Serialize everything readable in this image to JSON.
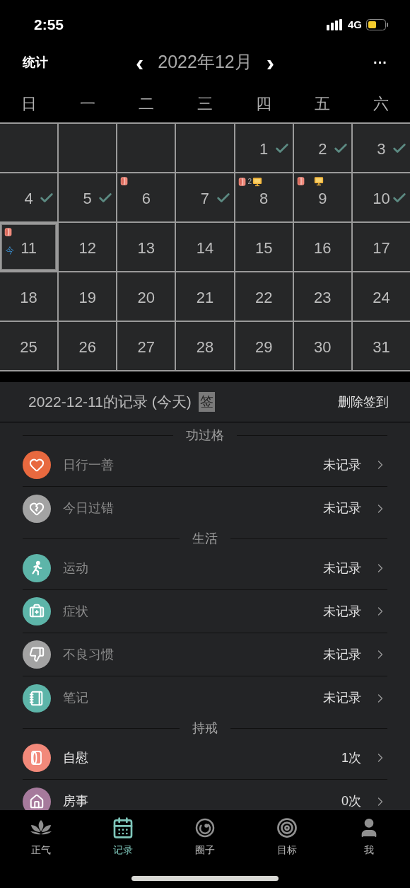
{
  "status_bar": {
    "time": "2:55",
    "network": "4G"
  },
  "header": {
    "left": "统计",
    "prev": "‹",
    "title": "2022年12月",
    "next": "›",
    "more": "···"
  },
  "weekdays": [
    "日",
    "一",
    "二",
    "三",
    "四",
    "五",
    "六"
  ],
  "calendar": [
    {
      "kind": "blank"
    },
    {
      "kind": "blank"
    },
    {
      "kind": "blank"
    },
    {
      "kind": "blank"
    },
    {
      "kind": "day",
      "day": "1",
      "checked": true,
      "selected": false,
      "roll": false,
      "screen": false
    },
    {
      "kind": "day",
      "day": "2",
      "checked": true,
      "selected": false,
      "roll": false,
      "screen": false
    },
    {
      "kind": "day",
      "day": "3",
      "checked": true,
      "selected": false,
      "roll": false,
      "screen": false
    },
    {
      "kind": "day",
      "day": "4",
      "checked": true,
      "selected": false,
      "roll": false,
      "screen": false
    },
    {
      "kind": "day",
      "day": "5",
      "checked": true,
      "selected": false,
      "roll": false,
      "screen": false
    },
    {
      "kind": "day",
      "day": "6",
      "checked": false,
      "selected": false,
      "roll": true,
      "screen": false
    },
    {
      "kind": "day",
      "day": "7",
      "checked": true,
      "selected": false,
      "roll": false,
      "screen": false
    },
    {
      "kind": "day",
      "day": "8",
      "checked": false,
      "selected": false,
      "roll": true,
      "roll_count": "2",
      "screen": true
    },
    {
      "kind": "day",
      "day": "9",
      "checked": false,
      "selected": false,
      "roll": true,
      "screen": true
    },
    {
      "kind": "day",
      "day": "10",
      "checked": true,
      "selected": false,
      "roll": false,
      "screen": false
    },
    {
      "kind": "day",
      "day": "11",
      "checked": false,
      "selected": true,
      "roll": true,
      "screen": false,
      "today_label": "今"
    },
    {
      "kind": "day",
      "day": "12",
      "checked": false,
      "selected": false,
      "roll": false,
      "screen": false
    },
    {
      "kind": "day",
      "day": "13",
      "checked": false,
      "selected": false,
      "roll": false,
      "screen": false
    },
    {
      "kind": "day",
      "day": "14",
      "checked": false,
      "selected": false,
      "roll": false,
      "screen": false
    },
    {
      "kind": "day",
      "day": "15",
      "checked": false,
      "selected": false,
      "roll": false,
      "screen": false
    },
    {
      "kind": "day",
      "day": "16",
      "checked": false,
      "selected": false,
      "roll": false,
      "screen": false
    },
    {
      "kind": "day",
      "day": "17",
      "checked": false,
      "selected": false,
      "roll": false,
      "screen": false
    },
    {
      "kind": "day",
      "day": "18",
      "checked": false,
      "selected": false,
      "roll": false,
      "screen": false
    },
    {
      "kind": "day",
      "day": "19",
      "checked": false,
      "selected": false,
      "roll": false,
      "screen": false
    },
    {
      "kind": "day",
      "day": "20",
      "checked": false,
      "selected": false,
      "roll": false,
      "screen": false
    },
    {
      "kind": "day",
      "day": "21",
      "checked": false,
      "selected": false,
      "roll": false,
      "screen": false
    },
    {
      "kind": "day",
      "day": "22",
      "checked": false,
      "selected": false,
      "roll": false,
      "screen": false
    },
    {
      "kind": "day",
      "day": "23",
      "checked": false,
      "selected": false,
      "roll": false,
      "screen": false
    },
    {
      "kind": "day",
      "day": "24",
      "checked": false,
      "selected": false,
      "roll": false,
      "screen": false
    },
    {
      "kind": "day",
      "day": "25",
      "checked": false,
      "selected": false,
      "roll": false,
      "screen": false
    },
    {
      "kind": "day",
      "day": "26",
      "checked": false,
      "selected": false,
      "roll": false,
      "screen": false
    },
    {
      "kind": "day",
      "day": "27",
      "checked": false,
      "selected": false,
      "roll": false,
      "screen": false
    },
    {
      "kind": "day",
      "day": "28",
      "checked": false,
      "selected": false,
      "roll": false,
      "screen": false
    },
    {
      "kind": "day",
      "day": "29",
      "checked": false,
      "selected": false,
      "roll": false,
      "screen": false
    },
    {
      "kind": "day",
      "day": "30",
      "checked": false,
      "selected": false,
      "roll": false,
      "screen": false
    },
    {
      "kind": "day",
      "day": "31",
      "checked": false,
      "selected": false,
      "roll": false,
      "screen": false
    }
  ],
  "record": {
    "title": "2022-12-11的记录 (今天)",
    "badge": "签",
    "action": "删除签到"
  },
  "sections": [
    {
      "title": "功过格",
      "items": [
        {
          "color": "#e8693f",
          "label": "日行一善",
          "value": "未记录",
          "recorded": false
        },
        {
          "color": "#a3a3a3",
          "label": "今日过错",
          "value": "未记录",
          "recorded": false
        }
      ]
    },
    {
      "title": "生活",
      "items": [
        {
          "color": "#5db5a9",
          "label": "运动",
          "value": "未记录",
          "recorded": false
        },
        {
          "color": "#5db5a9",
          "label": "症状",
          "value": "未记录",
          "recorded": false
        },
        {
          "color": "#a3a3a3",
          "label": "不良习惯",
          "value": "未记录",
          "recorded": false
        },
        {
          "color": "#5db5a9",
          "label": "笔记",
          "value": "未记录",
          "recorded": false
        }
      ]
    },
    {
      "title": "持戒",
      "items": [
        {
          "color": "#f2897a",
          "label": "自慰",
          "value": "1次",
          "recorded": true
        },
        {
          "color": "#a67a9c",
          "label": "房事",
          "value": "0次",
          "recorded": true
        }
      ]
    }
  ],
  "tabs": [
    {
      "label": "正气",
      "selected": false
    },
    {
      "label": "记录",
      "selected": true
    },
    {
      "label": "圈子",
      "selected": false
    },
    {
      "label": "目标",
      "selected": false
    },
    {
      "label": "我",
      "selected": false
    }
  ]
}
